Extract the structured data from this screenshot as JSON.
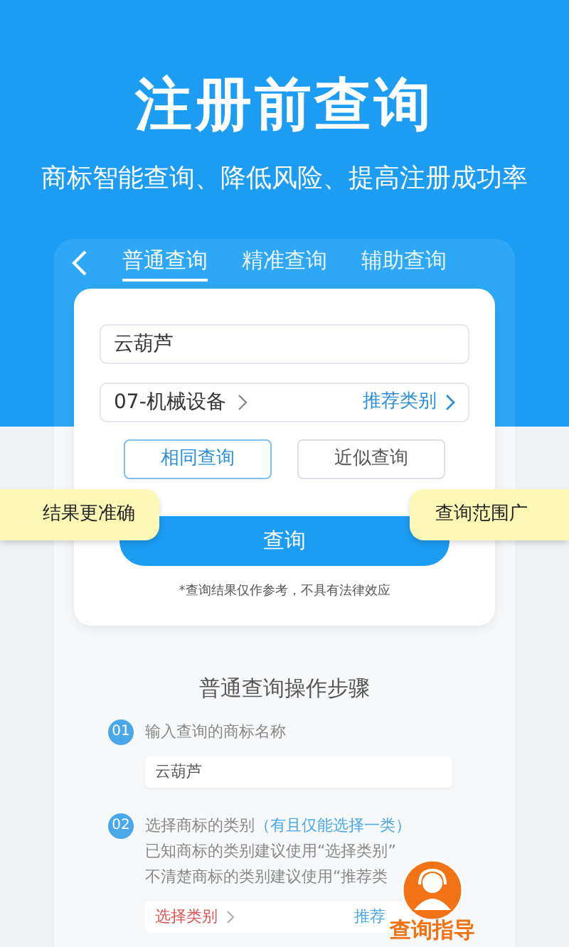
{
  "header": {
    "title": "注册前查询",
    "subtitle": "商标智能查询、降低风险、提高注册成功率"
  },
  "tabs": [
    {
      "label": "普通查询",
      "selected": true
    },
    {
      "label": "精准查询",
      "selected": false
    },
    {
      "label": "辅助查询",
      "selected": false
    }
  ],
  "form": {
    "name_value": "云葫芦",
    "category": "07-机械设备",
    "recommend": "推荐类别",
    "match_options": [
      {
        "label": "相同查询",
        "selected": true,
        "tip": "结果更准确"
      },
      {
        "label": "近似查询",
        "selected": false,
        "tip": "查询范围广"
      }
    ],
    "submit": "查询",
    "disclaimer": "*查询结果仅作参考，不具有法律效应"
  },
  "guide": {
    "title": "普通查询操作步骤",
    "steps": [
      {
        "kind": "input",
        "number": "01",
        "title": "输入查询的商标名称",
        "example": "云葫芦"
      },
      {
        "kind": "category",
        "number": "02",
        "title": "选择商标的类别",
        "note": "（有且仅能选择一类）",
        "lines": [
          "已知商标的类别建议使用“选择类别”",
          "不清楚商标的类别建议使用“推荐类"
        ],
        "pick": "选择类别",
        "recommend": "推荐"
      }
    ]
  },
  "help_button": {
    "label": "查询指导"
  }
}
